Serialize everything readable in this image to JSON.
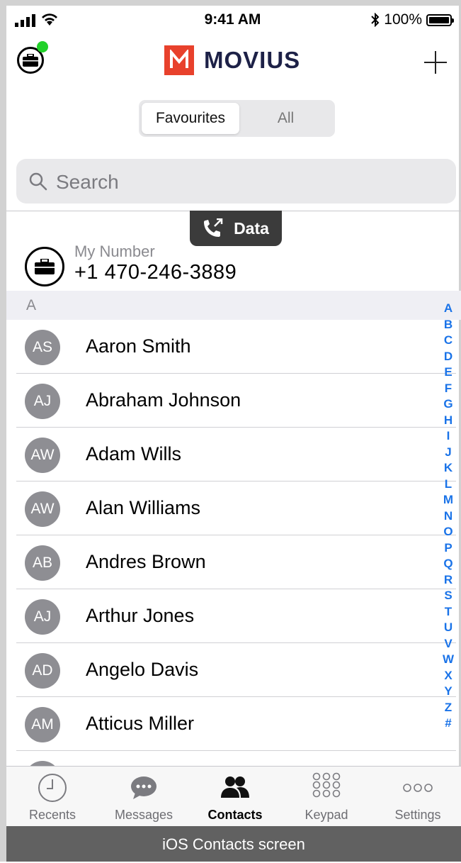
{
  "status_bar": {
    "time": "9:41 AM",
    "battery": "100%"
  },
  "header": {
    "logo_text": "MOVIUS"
  },
  "segment": {
    "favourites_label": "Favourites",
    "all_label": "All"
  },
  "search": {
    "placeholder": "Search"
  },
  "data_badge": {
    "label": "Data"
  },
  "my_number": {
    "label": "My Number",
    "value": "+1 470-246-3889"
  },
  "section": {
    "letter": "A"
  },
  "contacts": [
    {
      "initials": "AS",
      "name": "Aaron Smith"
    },
    {
      "initials": "AJ",
      "name": "Abraham Johnson"
    },
    {
      "initials": "AW",
      "name": "Adam Wills"
    },
    {
      "initials": "AW",
      "name": "Alan Williams"
    },
    {
      "initials": "AB",
      "name": "Andres Brown"
    },
    {
      "initials": "AJ",
      "name": "Arthur Jones"
    },
    {
      "initials": "AD",
      "name": "Angelo Davis"
    },
    {
      "initials": "AM",
      "name": "Atticus Miller"
    }
  ],
  "alphabet": [
    "A",
    "B",
    "C",
    "D",
    "E",
    "F",
    "G",
    "H",
    "I",
    "J",
    "K",
    "L",
    "M",
    "N",
    "O",
    "P",
    "Q",
    "R",
    "S",
    "T",
    "U",
    "V",
    "W",
    "X",
    "Y",
    "Z",
    "#"
  ],
  "tabs": [
    {
      "label": "Recents",
      "icon": "clock-icon"
    },
    {
      "label": "Messages",
      "icon": "chat-bubble-icon"
    },
    {
      "label": "Contacts",
      "icon": "contacts-icon",
      "active": true
    },
    {
      "label": "Keypad",
      "icon": "keypad-icon"
    },
    {
      "label": "Settings",
      "icon": "more-dots-icon"
    }
  ],
  "caption": "iOS Contacts screen",
  "colors": {
    "accent_blue": "#1a73e8",
    "brand_red": "#e8412c",
    "brand_navy": "#1d2147",
    "online_green": "#22d12a",
    "avatar_gray": "#8e8e93"
  }
}
